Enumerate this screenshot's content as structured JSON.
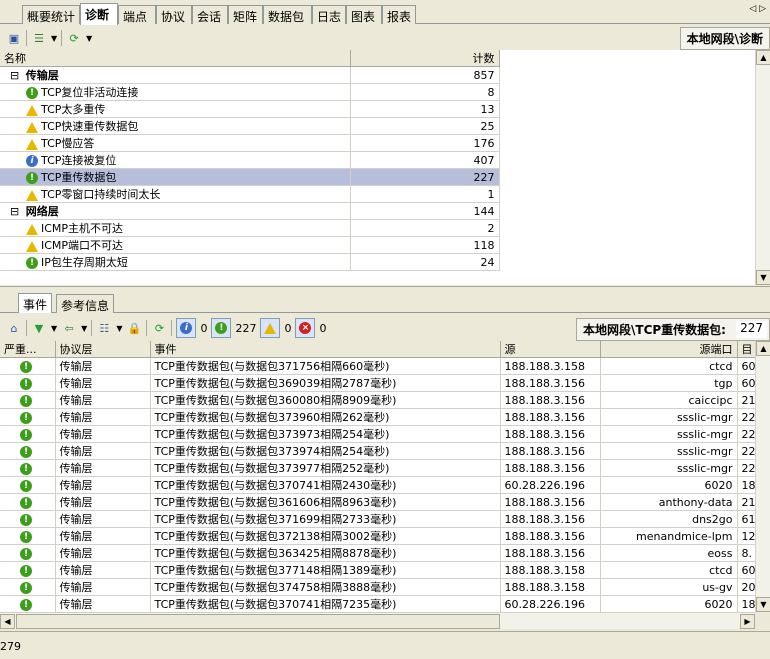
{
  "top_tabs": [
    "概要统计",
    "诊断",
    "端点",
    "协议",
    "会话",
    "矩阵",
    "数据包",
    "日志",
    "图表",
    "报表"
  ],
  "active_top_tab": "诊断",
  "top_path": "本地网段\\诊断",
  "diag_table": {
    "headers": [
      "名称",
      "计数"
    ],
    "rows": [
      {
        "type": "group",
        "label": "传输层",
        "count": "857"
      },
      {
        "icon": "green",
        "label": "TCP复位非活动连接",
        "count": "8"
      },
      {
        "icon": "warn",
        "label": "TCP太多重传",
        "count": "13"
      },
      {
        "icon": "warn",
        "label": "TCP快速重传数据包",
        "count": "25"
      },
      {
        "icon": "warn",
        "label": "TCP慢应答",
        "count": "176"
      },
      {
        "icon": "info",
        "label": "TCP连接被复位",
        "count": "407"
      },
      {
        "icon": "green",
        "label": "TCP重传数据包",
        "count": "227",
        "selected": true
      },
      {
        "icon": "warn",
        "label": "TCP零窗口持续时间太长",
        "count": "1"
      },
      {
        "type": "group",
        "label": "网络层",
        "count": "144"
      },
      {
        "icon": "warn",
        "label": "ICMP主机不可达",
        "count": "2"
      },
      {
        "icon": "warn",
        "label": "ICMP端口不可达",
        "count": "118"
      },
      {
        "icon": "green",
        "label": "IP包生存周期太短",
        "count": "24"
      }
    ]
  },
  "bottom_tabs": [
    "事件",
    "参考信息"
  ],
  "filters": {
    "info": "0",
    "green": "227",
    "warn": "0",
    "error": "0"
  },
  "bottom_path": "本地网段\\TCP重传数据包:",
  "bottom_path_count": "227",
  "events_table": {
    "headers": [
      "严重...",
      "协议层",
      "事件",
      "源",
      "源端口",
      "目"
    ],
    "rows": [
      [
        "传输层",
        "TCP重传数据包(与数据包371756相隔660毫秒)",
        "188.188.3.158",
        "ctcd",
        "60"
      ],
      [
        "传输层",
        "TCP重传数据包(与数据包369039相隔2787毫秒)",
        "188.188.3.156",
        "tgp",
        "60"
      ],
      [
        "传输层",
        "TCP重传数据包(与数据包360080相隔8909毫秒)",
        "188.188.3.156",
        "caiccipc",
        "21"
      ],
      [
        "传输层",
        "TCP重传数据包(与数据包373960相隔262毫秒)",
        "188.188.3.156",
        "ssslic-mgr",
        "22"
      ],
      [
        "传输层",
        "TCP重传数据包(与数据包373973相隔254毫秒)",
        "188.188.3.156",
        "ssslic-mgr",
        "22"
      ],
      [
        "传输层",
        "TCP重传数据包(与数据包373974相隔254毫秒)",
        "188.188.3.156",
        "ssslic-mgr",
        "22"
      ],
      [
        "传输层",
        "TCP重传数据包(与数据包373977相隔252毫秒)",
        "188.188.3.156",
        "ssslic-mgr",
        "22"
      ],
      [
        "传输层",
        "TCP重传数据包(与数据包370741相隔2430毫秒)",
        "60.28.226.196",
        "6020",
        "18"
      ],
      [
        "传输层",
        "TCP重传数据包(与数据包361606相隔8963毫秒)",
        "188.188.3.156",
        "anthony-data",
        "21"
      ],
      [
        "传输层",
        "TCP重传数据包(与数据包371699相隔2733毫秒)",
        "188.188.3.156",
        "dns2go",
        "61"
      ],
      [
        "传输层",
        "TCP重传数据包(与数据包372138相隔3002毫秒)",
        "188.188.3.156",
        "menandmice-lpm",
        "12"
      ],
      [
        "传输层",
        "TCP重传数据包(与数据包363425相隔8878毫秒)",
        "188.188.3.156",
        "eoss",
        "8."
      ],
      [
        "传输层",
        "TCP重传数据包(与数据包377148相隔1389毫秒)",
        "188.188.3.158",
        "ctcd",
        "60"
      ],
      [
        "传输层",
        "TCP重传数据包(与数据包374758相隔3888毫秒)",
        "188.188.3.158",
        "us-gv",
        "20"
      ],
      [
        "传输层",
        "TCP重传数据包(与数据包370741相隔7235毫秒)",
        "60.28.226.196",
        "6020",
        "18"
      ]
    ]
  },
  "status": "279"
}
